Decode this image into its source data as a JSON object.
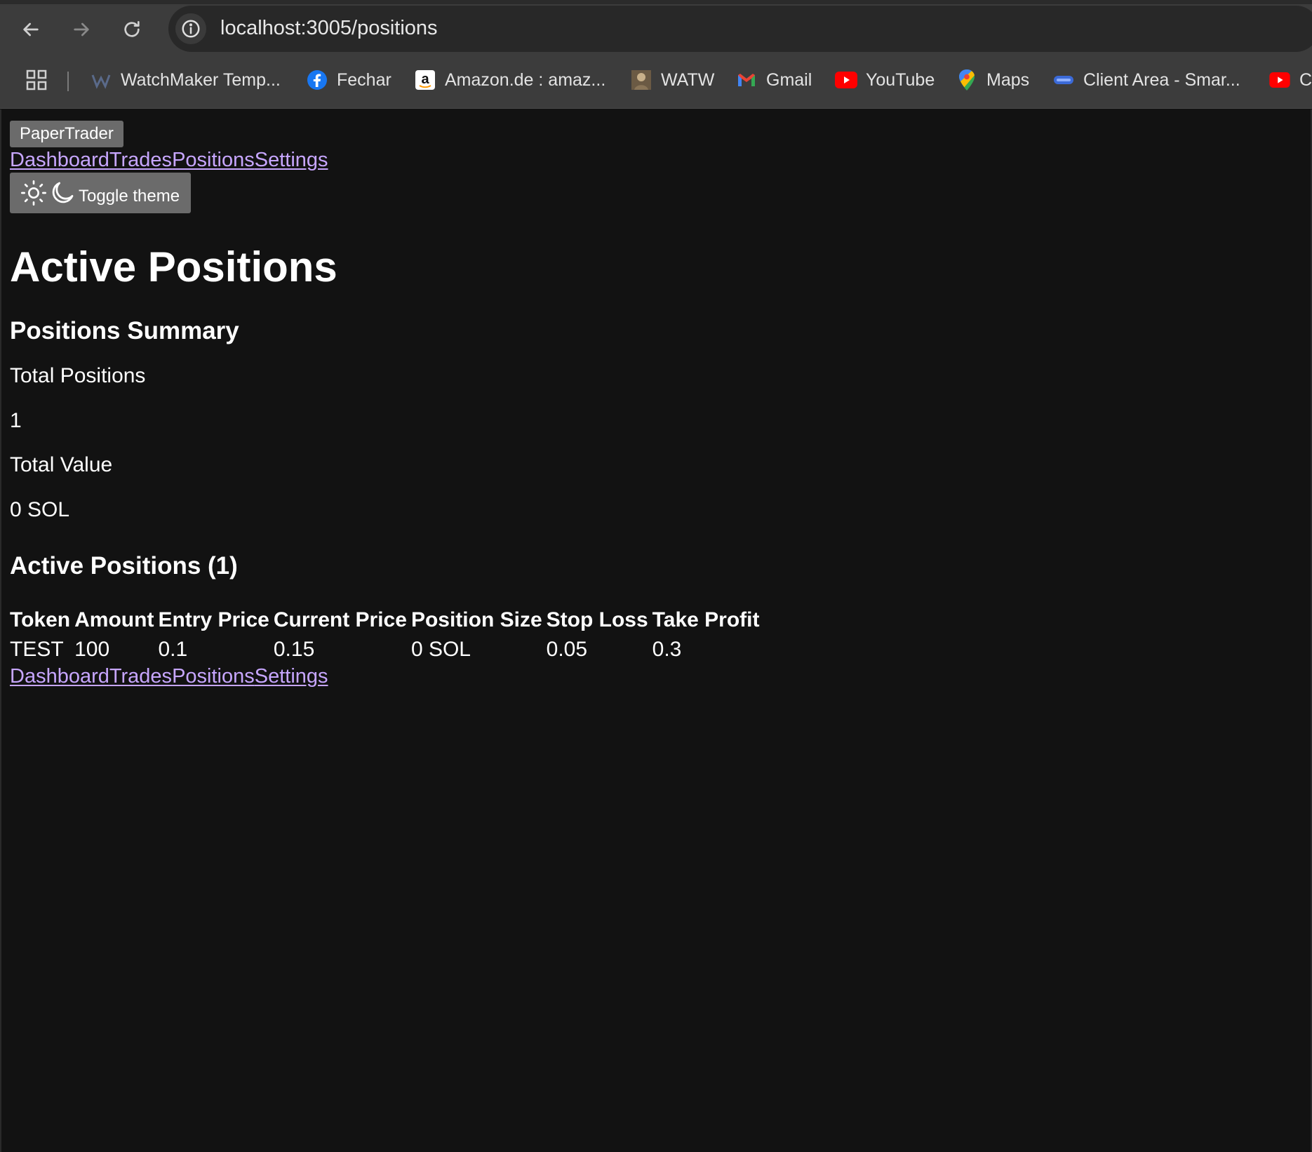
{
  "browser": {
    "url": "localhost:3005/positions",
    "bookmarks": [
      {
        "label": "WatchMaker Temp...",
        "icon": "watchmaker-icon"
      },
      {
        "label": "Fechar",
        "icon": "facebook-icon"
      },
      {
        "label": "Amazon.de : amaz...",
        "icon": "amazon-icon"
      },
      {
        "label": "WATW",
        "icon": "watw-icon"
      },
      {
        "label": "Gmail",
        "icon": "gmail-icon"
      },
      {
        "label": "YouTube",
        "icon": "youtube-icon"
      },
      {
        "label": "Maps",
        "icon": "maps-icon"
      },
      {
        "label": "Client Area - Smar...",
        "icon": "client-area-icon"
      },
      {
        "label": "C",
        "icon": "youtube-icon"
      }
    ]
  },
  "header": {
    "brand": "PaperTrader",
    "nav": [
      "Dashboard",
      "Trades",
      "Positions",
      "Settings"
    ],
    "theme_toggle_label": "Toggle theme"
  },
  "main": {
    "title": "Active Positions",
    "summary": {
      "heading": "Positions Summary",
      "total_positions_label": "Total Positions",
      "total_positions_value": "1",
      "total_value_label": "Total Value",
      "total_value_value": "0 SOL"
    },
    "positions": {
      "heading": "Active Positions (1)",
      "columns": [
        "Token",
        "Amount",
        "Entry Price",
        "Current Price",
        "Position Size",
        "Stop Loss",
        "Take Profit"
      ],
      "rows": [
        [
          "TEST",
          "100",
          "0.1",
          "0.15",
          "0 SOL",
          "0.05",
          "0.3"
        ]
      ]
    }
  },
  "footer": {
    "nav": [
      "Dashboard",
      "Trades",
      "Positions",
      "Settings"
    ]
  },
  "colors": {
    "background": "#121212",
    "link": "#c7a6ff",
    "button_bg": "#6b6b6b"
  }
}
